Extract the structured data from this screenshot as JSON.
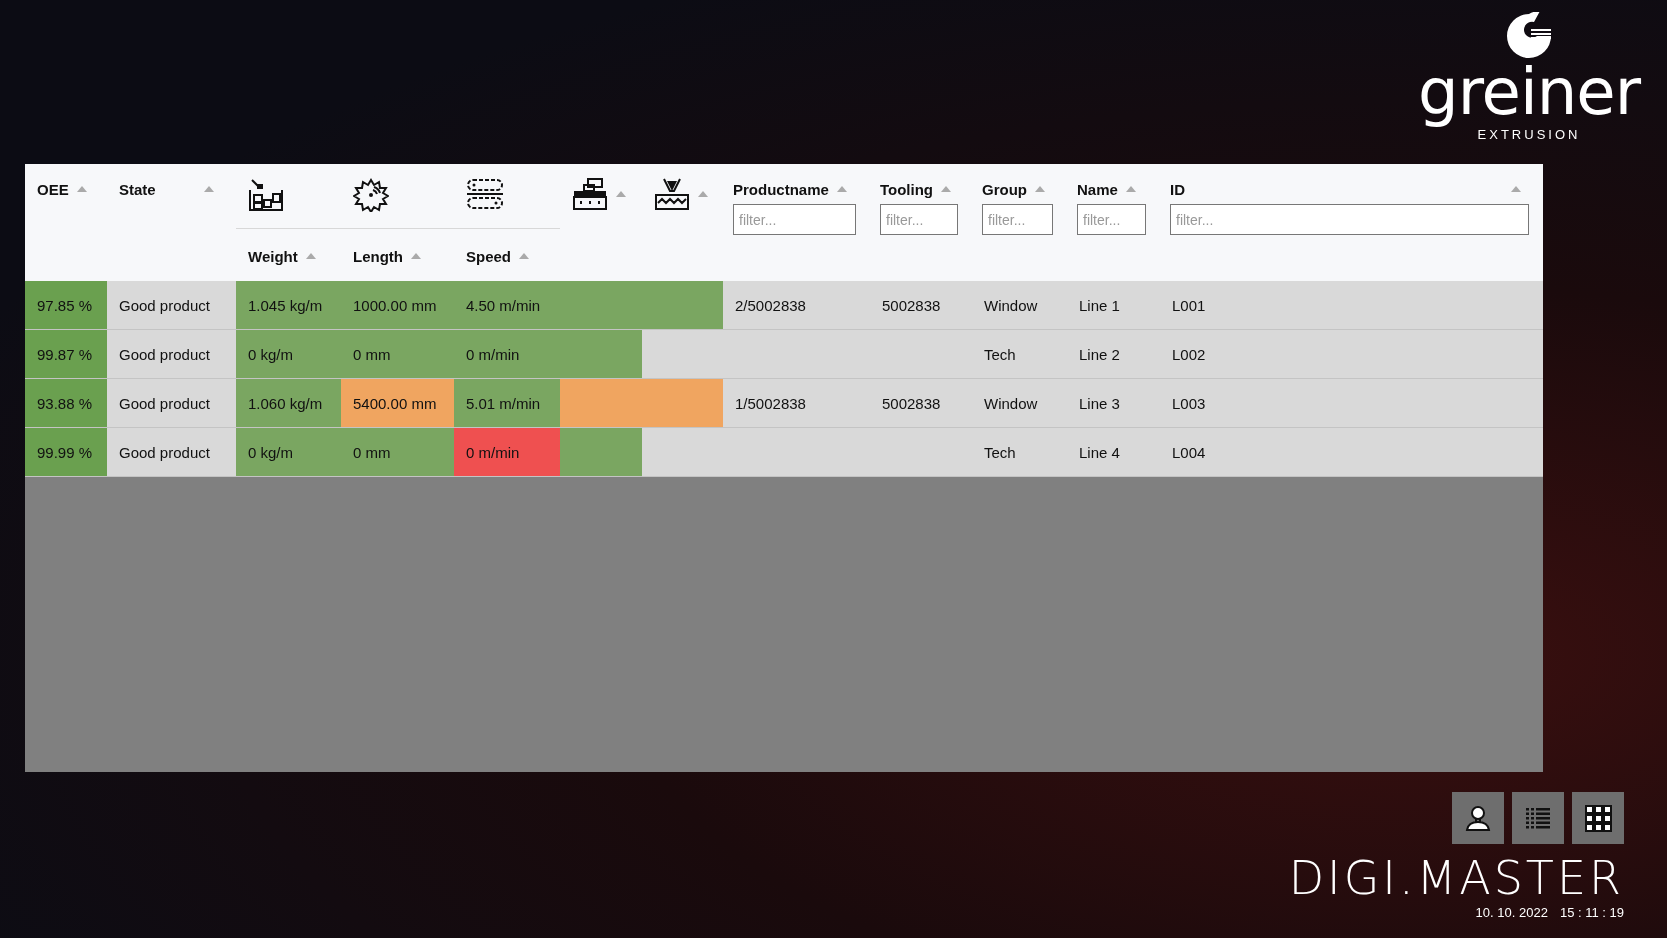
{
  "logo": {
    "name": "greiner",
    "subtitle": "EXTRUSION"
  },
  "header": {
    "columns": [
      {
        "kind": "text",
        "label": "OEE"
      },
      {
        "kind": "text",
        "label": "State"
      },
      {
        "kind": "icon_group",
        "sublabel": "Weight"
      },
      {
        "kind": "icon_group",
        "sublabel": "Length"
      },
      {
        "kind": "icon_group",
        "sublabel": "Speed"
      },
      {
        "kind": "icon"
      },
      {
        "kind": "icon"
      },
      {
        "kind": "filter",
        "label": "Productname",
        "placeholder": "filter..."
      },
      {
        "kind": "filter",
        "label": "Tooling",
        "placeholder": "filter..."
      },
      {
        "kind": "filter",
        "label": "Group",
        "placeholder": "filter..."
      },
      {
        "kind": "filter",
        "label": "Name",
        "placeholder": "filter..."
      },
      {
        "kind": "filter",
        "label": "ID",
        "placeholder": "filter..."
      }
    ]
  },
  "rows": [
    {
      "cells": [
        {
          "text": "97.85 %",
          "color": "#6aa04f"
        },
        {
          "text": "Good product"
        },
        {
          "text": "1.045 kg/m",
          "color": "#7aa661"
        },
        {
          "text": "1000.00 mm",
          "color": "#7aa661"
        },
        {
          "text": "4.50 m/min",
          "color": "#7aa661"
        },
        {
          "color": "#7aa661"
        },
        {
          "color": "#7aa661"
        },
        {
          "text": "2/5002838"
        },
        {
          "text": "5002838"
        },
        {
          "text": "Window"
        },
        {
          "text": "Line 1"
        },
        {
          "text": "L001"
        }
      ]
    },
    {
      "cells": [
        {
          "text": "99.87 %",
          "color": "#6aa04f"
        },
        {
          "text": "Good product"
        },
        {
          "text": "0 kg/m",
          "color": "#7aa661"
        },
        {
          "text": "0 mm",
          "color": "#7aa661"
        },
        {
          "text": "0 m/min",
          "color": "#7aa661"
        },
        {
          "color": "#7aa661"
        },
        {},
        {},
        {},
        {
          "text": "Tech"
        },
        {
          "text": "Line 2"
        },
        {
          "text": "L002"
        }
      ]
    },
    {
      "cells": [
        {
          "text": "93.88 %",
          "color": "#6aa04f"
        },
        {
          "text": "Good product"
        },
        {
          "text": "1.060 kg/m",
          "color": "#7aa661"
        },
        {
          "text": "5400.00 mm",
          "color": "#f0a560"
        },
        {
          "text": "5.01 m/min",
          "color": "#7aa661"
        },
        {
          "color": "#f0a560"
        },
        {
          "color": "#f0a560"
        },
        {
          "text": "1/5002838"
        },
        {
          "text": "5002838"
        },
        {
          "text": "Window"
        },
        {
          "text": "Line 3"
        },
        {
          "text": "L003"
        }
      ]
    },
    {
      "cells": [
        {
          "text": "99.99 %",
          "color": "#6aa04f"
        },
        {
          "text": "Good product"
        },
        {
          "text": "0 kg/m",
          "color": "#7aa661"
        },
        {
          "text": "0 mm",
          "color": "#7aa661"
        },
        {
          "text": "0 m/min",
          "color": "#ef5050"
        },
        {
          "color": "#7aa661"
        },
        {},
        {},
        {},
        {
          "text": "Tech"
        },
        {
          "text": "Line 4"
        },
        {
          "text": "L004"
        }
      ]
    }
  ],
  "footer": {
    "brand": "DIGI.MASTER",
    "date": "10. 10. 2022",
    "time": "15 : 11 : 19"
  }
}
